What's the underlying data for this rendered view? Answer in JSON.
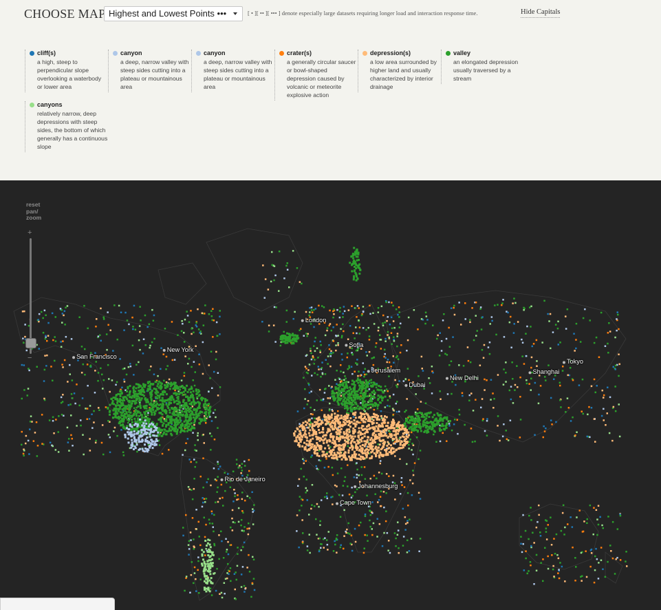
{
  "header": {
    "choose_label": "CHOOSE MAP:",
    "selected_map": "Highest and Lowest Points •••",
    "note": "[ • ][ •• ][ ••• ] denote especially large datasets requiring longer load and interaction response time.",
    "hide_capitals": "Hide Capitals"
  },
  "legend": [
    {
      "title": "cliff(s)",
      "color": "#1f77b4",
      "desc": "a high, steep to perpendicular slope overlooking a waterbody or lower area"
    },
    {
      "title": "canyon",
      "color": "#aec7e8",
      "desc": "a deep, narrow valley with steep sides cutting into a plateau or mountainous area"
    },
    {
      "title": "canyon",
      "color": "#aec7e8",
      "desc": "a deep, narrow valley with steep sides cutting into a plateau or mountainous area"
    },
    {
      "title": "crater(s)",
      "color": "#ff7f0e",
      "desc": "a generally circular saucer or bowl-shaped depression caused by volcanic or meteorite explosive action"
    },
    {
      "title": "depression(s)",
      "color": "#ffbb78",
      "desc": "a low area surrounded by higher land and usually characterized by interior drainage"
    },
    {
      "title": "valley",
      "color": "#2ca02c",
      "desc": "an elongated depression usually traversed by a stream"
    },
    {
      "title": "canyons",
      "color": "#98df8a",
      "desc": "relatively narrow, deep depressions with steep sides, the bottom of which generally has a continuous slope"
    }
  ],
  "map": {
    "reset_label": "reset pan/ zoom",
    "zoom_in": "+",
    "zoom_out": "−",
    "cities": [
      {
        "name": "San Francisco",
        "lon": -122.4,
        "lat": 37.8
      },
      {
        "name": "New York",
        "lon": -74.0,
        "lat": 40.7
      },
      {
        "name": "London",
        "lon": -0.1,
        "lat": 51.5
      },
      {
        "name": "Sofia",
        "lon": 23.3,
        "lat": 42.7
      },
      {
        "name": "Jerusalem",
        "lon": 35.2,
        "lat": 31.8
      },
      {
        "name": "Dubai",
        "lon": 55.3,
        "lat": 25.3
      },
      {
        "name": "New Delhi",
        "lon": 77.2,
        "lat": 28.6
      },
      {
        "name": "Shanghai",
        "lon": 121.5,
        "lat": 31.2
      },
      {
        "name": "Tokyo",
        "lon": 139.7,
        "lat": 35.7
      },
      {
        "name": "Rio de Janeiro",
        "lon": -43.2,
        "lat": -22.9
      },
      {
        "name": "Johannesburg",
        "lon": 28.0,
        "lat": -26.2
      },
      {
        "name": "Cape Town",
        "lon": 18.4,
        "lat": -33.9
      }
    ]
  }
}
